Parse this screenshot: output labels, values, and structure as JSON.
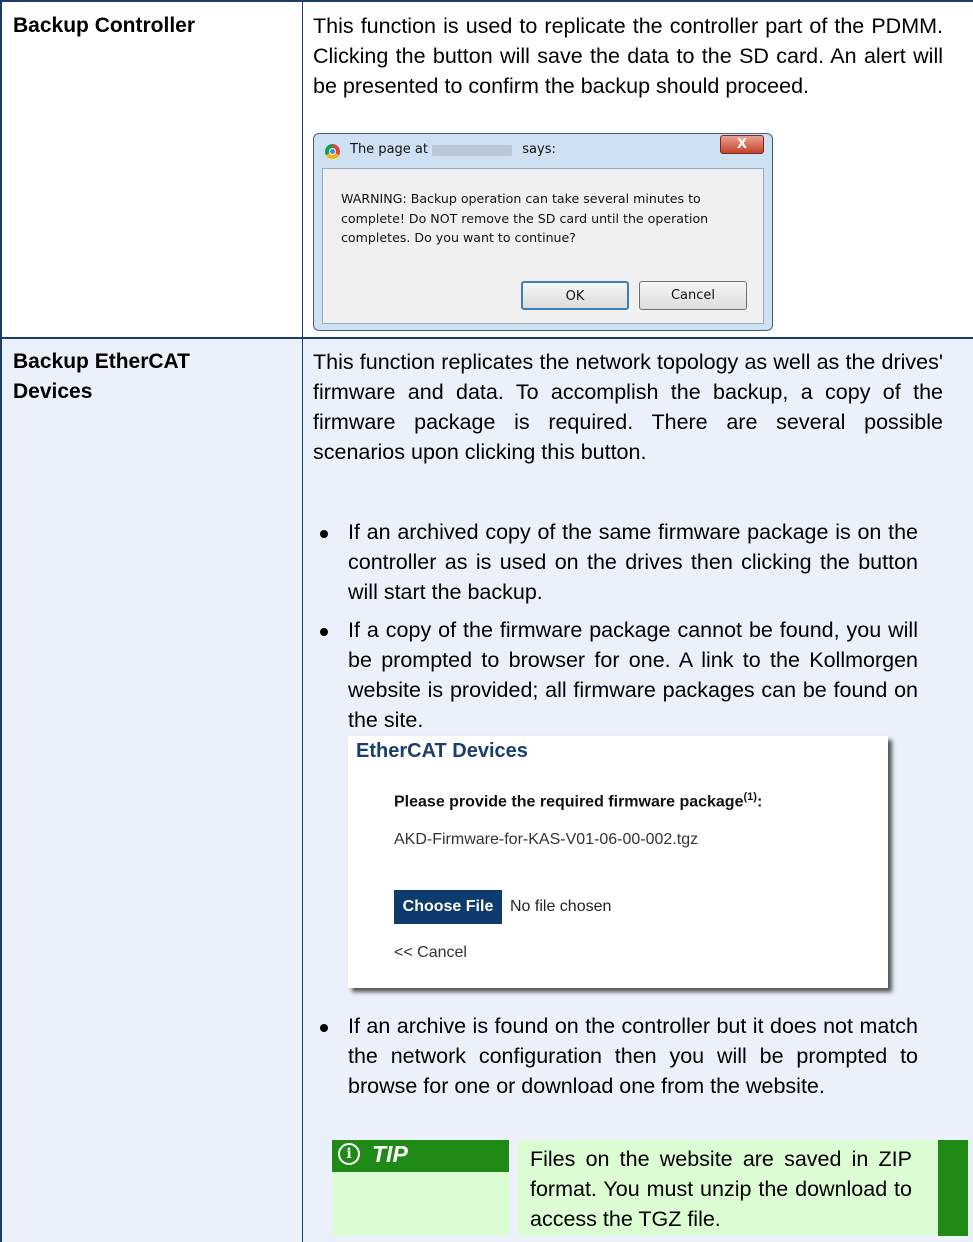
{
  "rows": [
    {
      "term": "Backup Controller",
      "description": "This function is used to replicate the controller part of the PDMM. Clicking the button will save the data to the SD card. An alert will be presented to confirm the backup should proceed."
    },
    {
      "term": "Backup EtherCAT Devices",
      "description": "This function replicates the network topology as well as the drives' firmware and data. To accomplish the backup, a copy of the firmware package is required. There are several possible scenarios upon clicking this button."
    }
  ],
  "dialog": {
    "title_prefix": "The page at",
    "title_suffix": "says:",
    "close_glyph": "X",
    "message": "WARNING: Backup operation can take several minutes to complete! Do NOT remove the SD card until the operation completes. Do you want to continue?",
    "ok_label": "OK",
    "cancel_label": "Cancel"
  },
  "bullets": [
    "If an archived copy of the same firmware package is on the controller as is used on the drives then clicking the button will start the backup.",
    "If a copy of the firmware package cannot be found, you will be prompted to browser for one. A link to the Kollmorgen website is provided; all firmware packages can be found on the site.",
    "If an archive is found on the controller but it does not match the network configuration then you will be prompted to browse for one or download one from the website."
  ],
  "ethercat_panel": {
    "title": "EtherCAT Devices",
    "prompt": "Please provide the required firmware package",
    "prompt_footnote": "(1)",
    "prompt_colon": ":",
    "filename": "AKD-Firmware-for-KAS-V01-06-00-002.tgz",
    "choose_file_label": "Choose File",
    "no_file_text": "No file chosen",
    "cancel_link": "<< Cancel"
  },
  "tip": {
    "icon_glyph": "i",
    "label": "TIP",
    "text": "Files on the website are saved in ZIP format. You must unzip the download to access the TGZ file."
  },
  "colors": {
    "border": "#1e3a6e",
    "row2_background": "#eaf1fa",
    "tip_green": "#1f8a16",
    "tip_background": "#dcfcd4",
    "ethercat_title": "#1b3e6e",
    "choose_button": "#0d3b6e"
  }
}
